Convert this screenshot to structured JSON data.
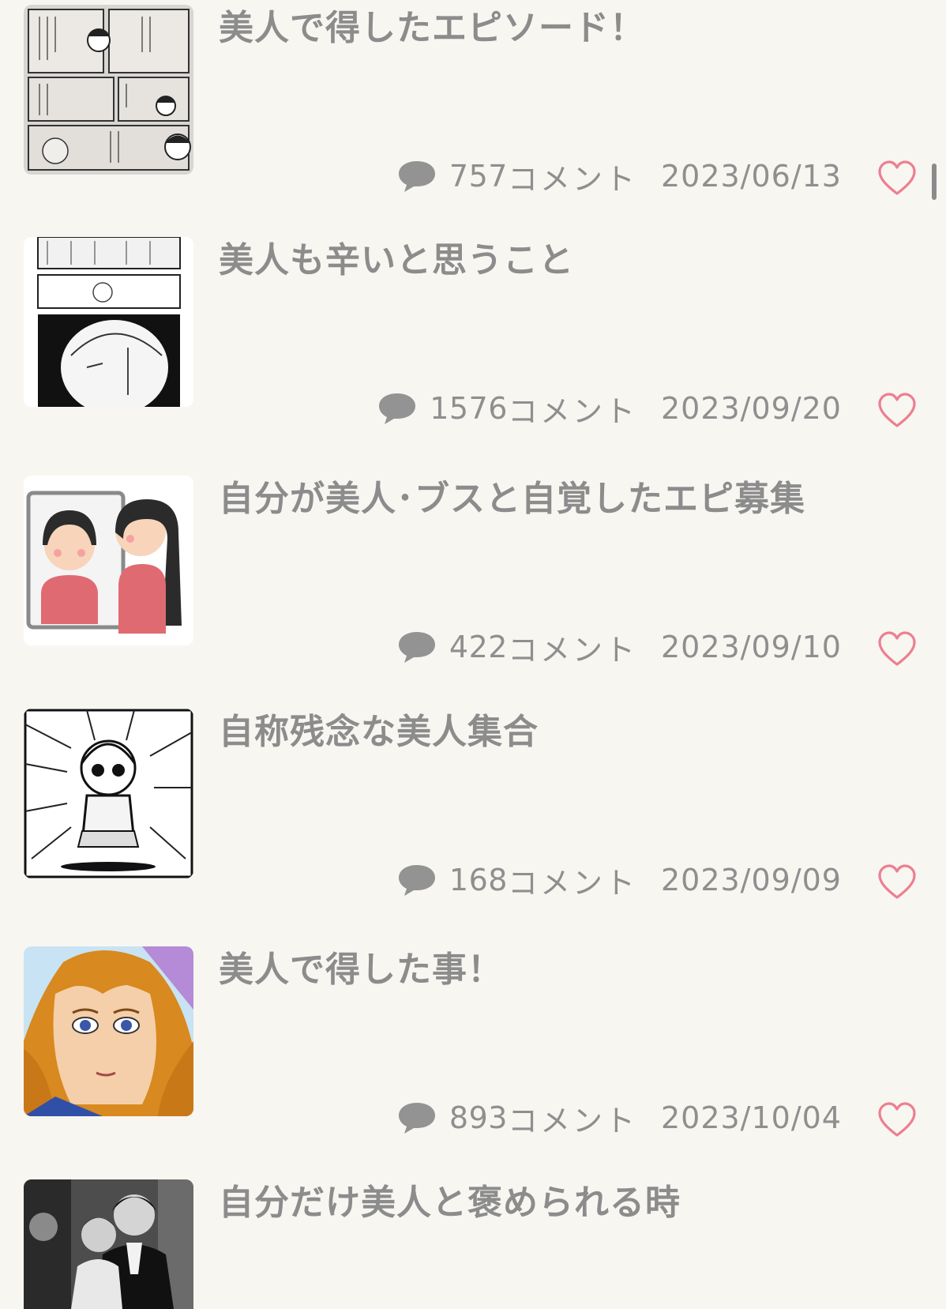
{
  "topics": [
    {
      "title": "美人で得したエピソード！",
      "comment_count": "757",
      "comment_unit": "コメント",
      "date": "2023/06/13",
      "thumbnail_icon": "manga-panel-thumbnail"
    },
    {
      "title": "美人も辛いと思うこと",
      "comment_count": "1576",
      "comment_unit": "コメント",
      "date": "2023/09/20",
      "thumbnail_icon": "manga-panel-thumbnail"
    },
    {
      "title": "自分が美人･ブスと自覚したエピ募集",
      "comment_count": "422",
      "comment_unit": "コメント",
      "date": "2023/09/10",
      "thumbnail_icon": "mirror-illustration-thumbnail"
    },
    {
      "title": "自称残念な美人集合",
      "comment_count": "168",
      "comment_unit": "コメント",
      "date": "2023/09/09",
      "thumbnail_icon": "manga-character-thumbnail"
    },
    {
      "title": "美人で得した事！",
      "comment_count": "893",
      "comment_unit": "コメント",
      "date": "2023/10/04",
      "thumbnail_icon": "shoujo-manga-thumbnail"
    },
    {
      "title": "自分だけ美人と褒められる時",
      "comment_count": "",
      "comment_unit": "",
      "date": "",
      "thumbnail_icon": "couple-photo-thumbnail"
    }
  ],
  "icons": {
    "comment": "speech-bubble-icon",
    "like": "heart-outline-icon"
  },
  "colors": {
    "background": "#f8f6f1",
    "text": "#8c8c8c",
    "heart": "#ec7f90"
  }
}
